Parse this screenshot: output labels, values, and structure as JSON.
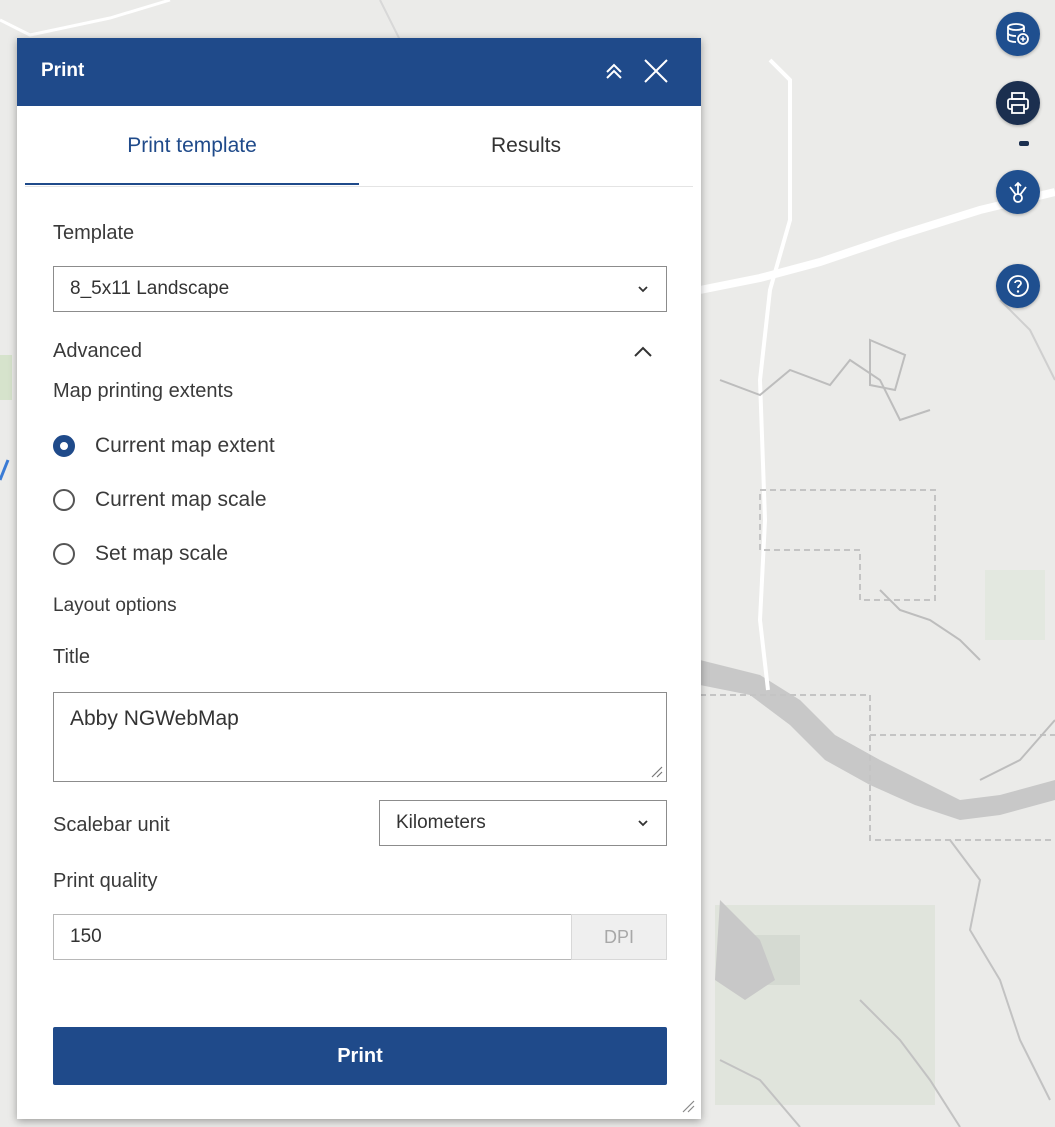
{
  "panel": {
    "title": "Print",
    "tabs": [
      {
        "label": "Print template",
        "active": true
      },
      {
        "label": "Results",
        "active": false
      }
    ],
    "template_label": "Template",
    "template_value": "8_5x11 Landscape",
    "advanced_label": "Advanced",
    "extents_label": "Map printing extents",
    "extent_options": [
      {
        "label": "Current map extent",
        "checked": true
      },
      {
        "label": "Current map scale",
        "checked": false
      },
      {
        "label": "Set map scale",
        "checked": false
      }
    ],
    "layout_label": "Layout options",
    "title_label": "Title",
    "title_value": "Abby NGWebMap",
    "scalebar_label": "Scalebar unit",
    "scalebar_value": "Kilometers",
    "quality_label": "Print quality",
    "quality_value": "150",
    "quality_unit": "DPI",
    "print_button": "Print"
  },
  "toolbar": {
    "icons": [
      "add-data-icon",
      "print-icon",
      "share-icon",
      "help-icon"
    ],
    "active": "print-icon"
  },
  "colors": {
    "header": "#1f4a8a",
    "tool_button": "#1f4f8f",
    "tool_button_active": "#1b2f4f",
    "map_background": "#ebebe9"
  }
}
